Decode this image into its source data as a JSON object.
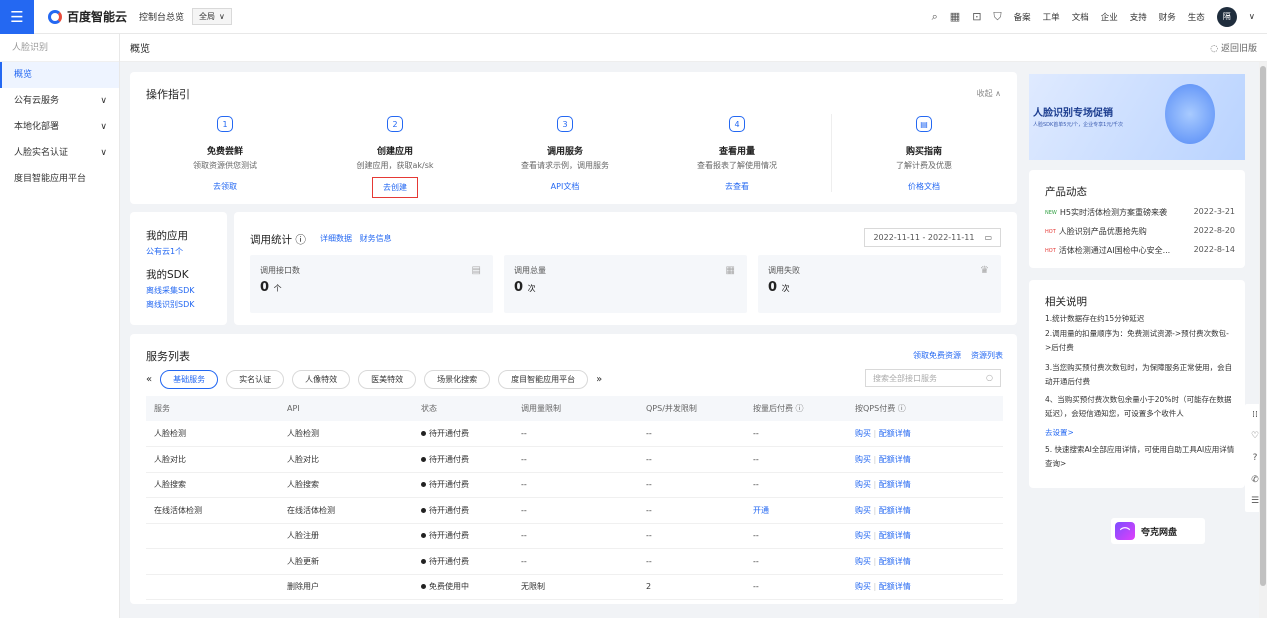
{
  "topbar": {
    "menu_icon": "☰",
    "logo": "百度智能云",
    "console": "控制台总览",
    "region": "全局",
    "region_arrow": "∨",
    "icons": [
      "⌕",
      "▦",
      "⊡",
      "⛉"
    ],
    "items": [
      "备案",
      "工单",
      "文档",
      "企业",
      "支持",
      "财务",
      "生态"
    ],
    "avatar": "隔",
    "avatar_arrow": "∨"
  },
  "sidebar": {
    "title": "人脸识别",
    "items": [
      {
        "label": "概览",
        "arrow": ""
      },
      {
        "label": "公有云服务",
        "arrow": "∨"
      },
      {
        "label": "本地化部署",
        "arrow": "∨"
      },
      {
        "label": "人脸实名认证",
        "arrow": "∨"
      },
      {
        "label": "度目智能应用平台",
        "arrow": ""
      }
    ]
  },
  "crumb": {
    "title": "概览",
    "back": "◌ 返回旧版"
  },
  "guide": {
    "title": "操作指引",
    "collapse": "收起 ∧",
    "steps": [
      {
        "num": "1",
        "name": "免费尝鲜",
        "desc": "领取资源供您测试",
        "link": "去领取"
      },
      {
        "num": "2",
        "name": "创建应用",
        "desc": "创建应用，获取ak/sk",
        "link": "去创建"
      },
      {
        "num": "3",
        "name": "调用服务",
        "desc": "查看请求示例，调用服务",
        "link": "API文档"
      },
      {
        "num": "4",
        "name": "查看用量",
        "desc": "查看报表了解使用情况",
        "link": "去查看"
      },
      {
        "num": "▤",
        "name": "购买指南",
        "desc": "了解计费及优惠",
        "link": "价格文档"
      }
    ]
  },
  "apps": {
    "my_apps": "我的应用",
    "apps_link": "公有云1个",
    "my_sdk": "我的SDK",
    "sdk_links": [
      "离线采集SDK",
      "离线识别SDK"
    ]
  },
  "stats": {
    "title": "调用统计 ⓘ",
    "links": [
      "详细数据",
      "财务信息"
    ],
    "date": "2022-11-11 - 2022-11-11",
    "date_icon": "▭",
    "boxes": [
      {
        "label": "调用接口数",
        "value": "0",
        "unit": "个",
        "icon": "▤"
      },
      {
        "label": "调用总量",
        "value": "0",
        "unit": "次",
        "icon": "▦"
      },
      {
        "label": "调用失败",
        "value": "0",
        "unit": "次",
        "icon": "♛"
      }
    ]
  },
  "services": {
    "title": "服务列表",
    "links": [
      "领取免费资源",
      "资源列表"
    ],
    "prev": "«",
    "next": "»",
    "tabs": [
      "基础服务",
      "实名认证",
      "人像特效",
      "医美特效",
      "场景化搜索",
      "度目智能应用平台"
    ],
    "search_placeholder": "搜索全部接口服务",
    "search_icon": "○",
    "columns": [
      "服务",
      "API",
      "状态",
      "调用量限制",
      "QPS/并发限制",
      "按量后付费 ⓘ",
      "按QPS付费 ⓘ"
    ],
    "rows": [
      {
        "svc": "人脸检测",
        "api": "人脸检测",
        "status": "待开通付费",
        "limit": "--",
        "qps": "--",
        "postpay": "--",
        "buy": "购买",
        "cfg": "配额详情"
      },
      {
        "svc": "人脸对比",
        "api": "人脸对比",
        "status": "待开通付费",
        "limit": "--",
        "qps": "--",
        "postpay": "--",
        "buy": "购买",
        "cfg": "配额详情"
      },
      {
        "svc": "人脸搜索",
        "api": "人脸搜索",
        "status": "待开通付费",
        "limit": "--",
        "qps": "--",
        "postpay": "--",
        "buy": "购买",
        "cfg": "配额详情"
      },
      {
        "svc": "在线活体检测",
        "api": "在线活体检测",
        "status": "待开通付费",
        "limit": "--",
        "qps": "--",
        "postpay": "开通",
        "buy": "购买",
        "cfg": "配额详情"
      },
      {
        "svc": "",
        "api": "人脸注册",
        "status": "待开通付费",
        "limit": "--",
        "qps": "--",
        "postpay": "--",
        "buy": "购买",
        "cfg": "配额详情"
      },
      {
        "svc": "",
        "api": "人脸更新",
        "status": "待开通付费",
        "limit": "--",
        "qps": "--",
        "postpay": "--",
        "buy": "购买",
        "cfg": "配额详情"
      },
      {
        "svc": "",
        "api": "删除用户",
        "status": "免费使用中",
        "limit": "无限制",
        "qps": "2",
        "postpay": "--",
        "buy": "购买",
        "cfg": "配额详情"
      }
    ]
  },
  "banner": {
    "title": "人脸识别专场促销",
    "sub": "人脸SDK首单5元/个，企业专享1元/千次"
  },
  "news": {
    "title": "产品动态",
    "items": [
      {
        "tag": "NEW",
        "tag_color": "#2e9e3f",
        "text": "H5实时活体检测方案重磅来袭",
        "date": "2022-3-21"
      },
      {
        "tag": "HOT",
        "tag_color": "#e53935",
        "text": "人脸识别产品优惠抢先购",
        "date": "2022-8-20"
      },
      {
        "tag": "HOT",
        "tag_color": "#e53935",
        "text": "活体检测通过AI国检中心安全...",
        "date": "2022-8-14"
      }
    ]
  },
  "notes": {
    "title": "相关说明",
    "lines": [
      "1.统计数据存在约15分钟延迟",
      "2.调用量的扣量顺序为：免费测试资源->预付费次数包->后付费",
      "3.当您购买预付费次数包时，为保障服务正常使用，会自动开通后付费",
      "4、当购买预付费次数包余量小于20%时（可能存在数据延迟），会短信通知您，可设置多个收件人",
      "去设置>",
      "5. 快速搜索AI全部应用详情，可使用自助工具AI应用详情查询>"
    ]
  },
  "pan": {
    "icon": "⌒",
    "label": "夸克网盘"
  },
  "tools": [
    "⁞⁞",
    "♡",
    "?",
    "✆",
    "☰"
  ]
}
